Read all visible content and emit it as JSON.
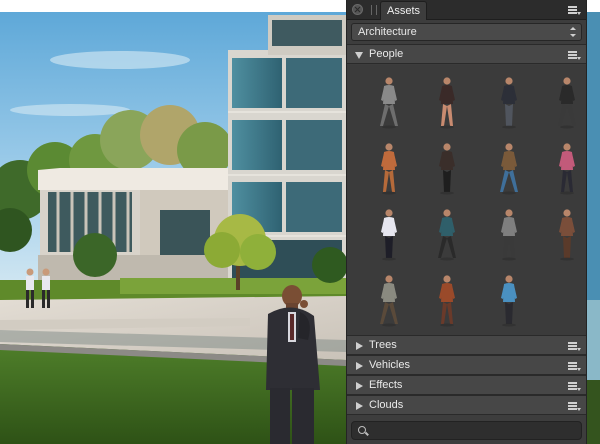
{
  "panel": {
    "tab_label": "Assets",
    "library_select": {
      "value": "Architecture"
    },
    "categories": [
      {
        "label": "People",
        "expanded": true
      },
      {
        "label": "Trees",
        "expanded": false
      },
      {
        "label": "Vehicles",
        "expanded": false
      },
      {
        "label": "Effects",
        "expanded": false
      },
      {
        "label": "Clouds",
        "expanded": false
      }
    ],
    "people_assets": [
      {
        "icon": "person-woman-shopping-bags-icon",
        "coat": "#8a8a8a",
        "legs": "#6e6e6e"
      },
      {
        "icon": "person-woman-walking-icon",
        "coat": "#3a2a28",
        "legs": "#c98b70"
      },
      {
        "icon": "person-man-walking-icon",
        "coat": "#2c2f38",
        "legs": "#50555e"
      },
      {
        "icon": "person-man-dark-suit-icon",
        "coat": "#2a2a2a",
        "legs": "#3a3a3a"
      },
      {
        "icon": "person-woman-orange-coat-icon",
        "coat": "#c06b3c",
        "legs": "#b56a3a"
      },
      {
        "icon": "person-woman-dark-dress-icon",
        "coat": "#3a2e2a",
        "legs": "#1e1e1e"
      },
      {
        "icon": "person-man-jeans-icon",
        "coat": "#7a5a3a",
        "legs": "#3f6f9a"
      },
      {
        "icon": "person-woman-pink-top-icon",
        "coat": "#c25a7a",
        "legs": "#2a2a34"
      },
      {
        "icon": "person-man-white-shirt-icon",
        "coat": "#e6e6ef",
        "legs": "#1e1e28"
      },
      {
        "icon": "person-woman-teal-top-icon",
        "coat": "#2f5f6a",
        "legs": "#2a2a2a"
      },
      {
        "icon": "person-man-gray-shirt-icon",
        "coat": "#7f7f7f",
        "legs": "#3a3a3a"
      },
      {
        "icon": "person-woman-brown-coat-icon",
        "coat": "#7a4e3a",
        "legs": "#5a3a2a"
      },
      {
        "icon": "person-man-gray-jacket-icon",
        "coat": "#8a8a80",
        "legs": "#5a4a3a"
      },
      {
        "icon": "person-woman-rust-coat-icon",
        "coat": "#9a4a2a",
        "legs": "#6a3a2a"
      },
      {
        "icon": "person-man-blue-shirt-icon",
        "coat": "#4a90c0",
        "legs": "#2a2a30"
      }
    ],
    "search": {
      "value": "",
      "placeholder": ""
    }
  },
  "colors": {
    "panel_bg": "#3d3d3d",
    "category_bg": "#474747",
    "sky": "#74b9e0",
    "lawn": "#3f6b20"
  }
}
